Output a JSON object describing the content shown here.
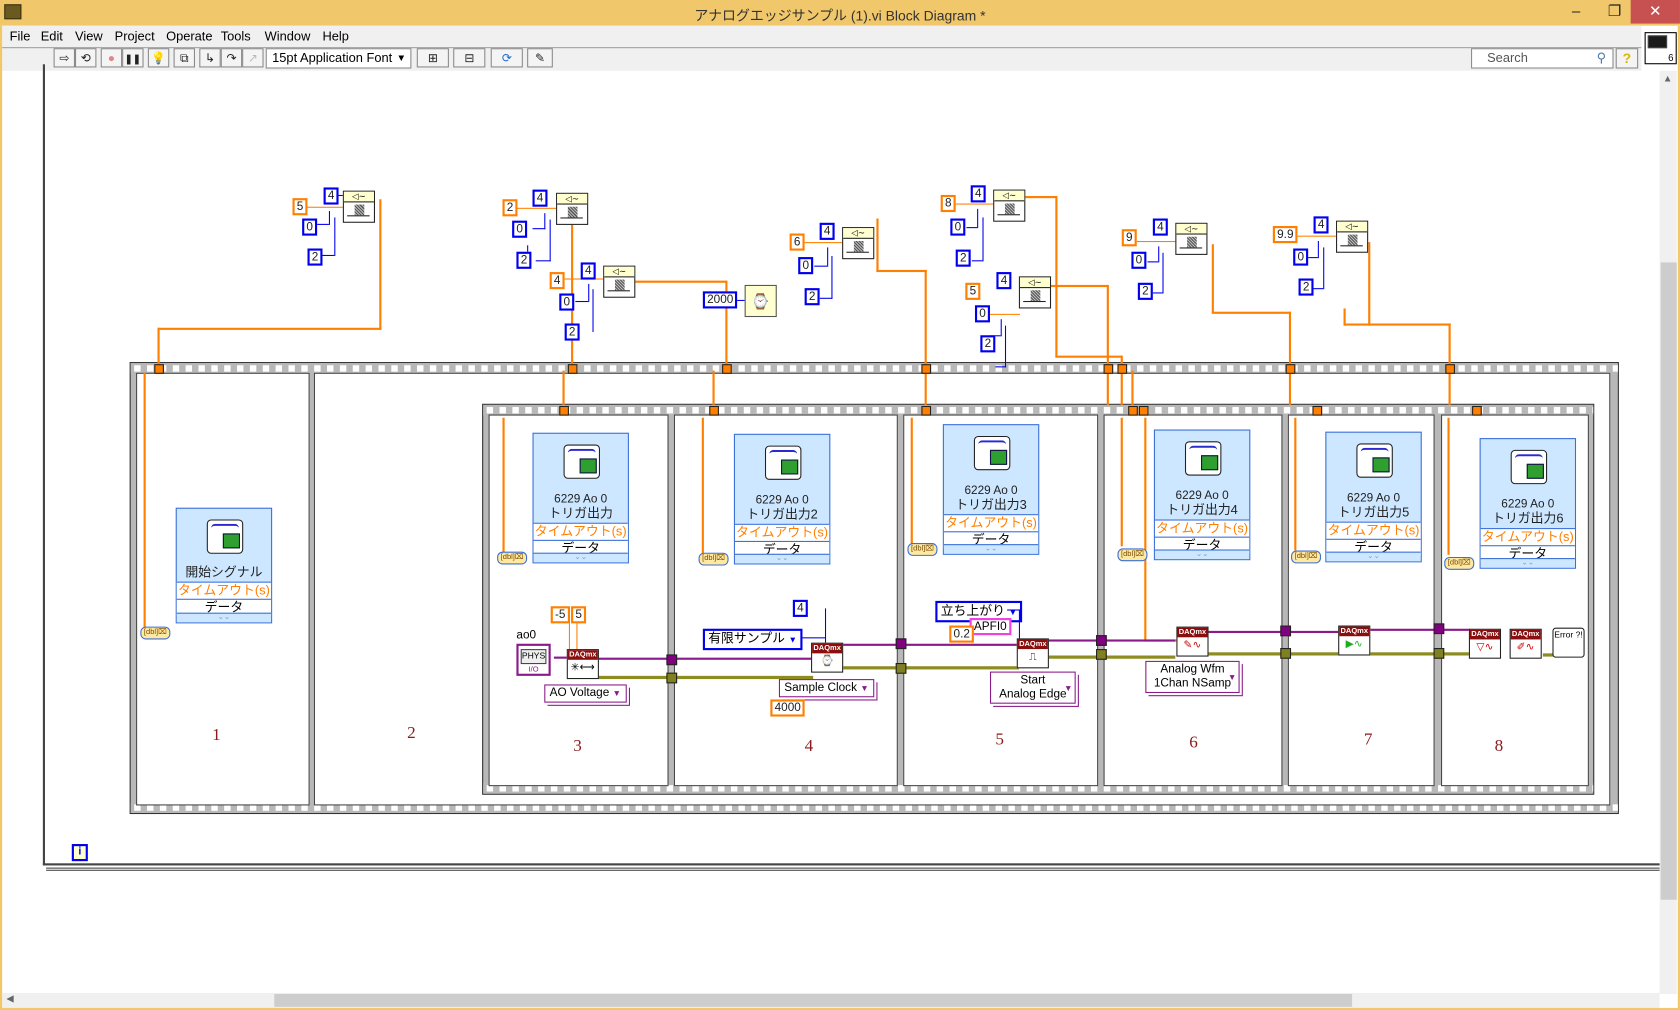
{
  "window": {
    "title": "アナログエッジサンプル (1).vi Block Diagram *",
    "controls": {
      "minimize": "–",
      "maximize": "❐",
      "close": "✕"
    }
  },
  "menu": [
    "File",
    "Edit",
    "View",
    "Project",
    "Operate",
    "Tools",
    "Window",
    "Help"
  ],
  "toolbar": {
    "run": "⇨",
    "run_continuously": "⟲",
    "abort": "●",
    "pause": "❚❚",
    "highlight": "💡",
    "retain_wire": "⧉",
    "step_into": "↳",
    "step_over": "↷",
    "step_out": "↗",
    "font": "15pt Application Font",
    "align": "⊞",
    "distribute": "⊟",
    "reorder": "⟳",
    "cleanup": "✎",
    "search_placeholder": "Search",
    "help": "?",
    "vi_icon_number": "6"
  },
  "diagram": {
    "sequence_frames": [
      "1",
      "2",
      "3",
      "4",
      "5",
      "6",
      "7",
      "8"
    ],
    "timing_nodes": [
      {
        "value": "5",
        "a": "4",
        "b": "0",
        "c": "2"
      },
      {
        "value": "2",
        "a": "4",
        "b": "0",
        "c": "2"
      },
      {
        "value": "4",
        "a": "4",
        "b": "0",
        "c": "2"
      },
      {
        "value": "6",
        "a": "4",
        "b": "0",
        "c": "2"
      },
      {
        "value": "8",
        "a": "4",
        "b": "0",
        "c": "2"
      },
      {
        "value": "5",
        "a": "4",
        "b": "0",
        "c": "2"
      },
      {
        "value": "9",
        "a": "4",
        "b": "0",
        "c": "2"
      },
      {
        "value": "9.9",
        "a": "4",
        "b": "0",
        "c": "2"
      }
    ],
    "wait_ms": "2000",
    "express_vis": [
      {
        "name1": "",
        "name2": "開始シグナル"
      },
      {
        "name1": "6229 Ao 0",
        "name2": "トリガ出力"
      },
      {
        "name1": "6229 Ao 0",
        "name2": "トリガ出力2"
      },
      {
        "name1": "6229 Ao 0",
        "name2": "トリガ出力3"
      },
      {
        "name1": "6229 Ao 0",
        "name2": "トリガ出力4"
      },
      {
        "name1": "6229 Ao 0",
        "name2": "トリガ出力5"
      },
      {
        "name1": "6229 Ao 0",
        "name2": "トリガ出力6"
      }
    ],
    "express_rows": {
      "timeout": "タイムアウト(s)",
      "data": "データ",
      "expand": "⌄⌄"
    },
    "dbl_label": "[dbl]⌧",
    "ao": {
      "channel_label": "ao0",
      "phys_label": "PHYS",
      "io_label": "I/O",
      "min": "-5",
      "max": "5",
      "create_type": "AO Voltage"
    },
    "timing": {
      "mode": "有限サンプル",
      "samples": "4",
      "type": "Sample Clock",
      "rate": "4000"
    },
    "trigger": {
      "edge": "立ち上がり",
      "source": "APFI0",
      "level": "0.2",
      "type_line1": "Start",
      "type_line2": "Analog Edge"
    },
    "write": {
      "type_line1": "Analog Wfm",
      "type_line2": "1Chan NSamp"
    },
    "daqmx_header": "DAQmx",
    "error_label": "Error ?!",
    "iteration_label": "i"
  }
}
